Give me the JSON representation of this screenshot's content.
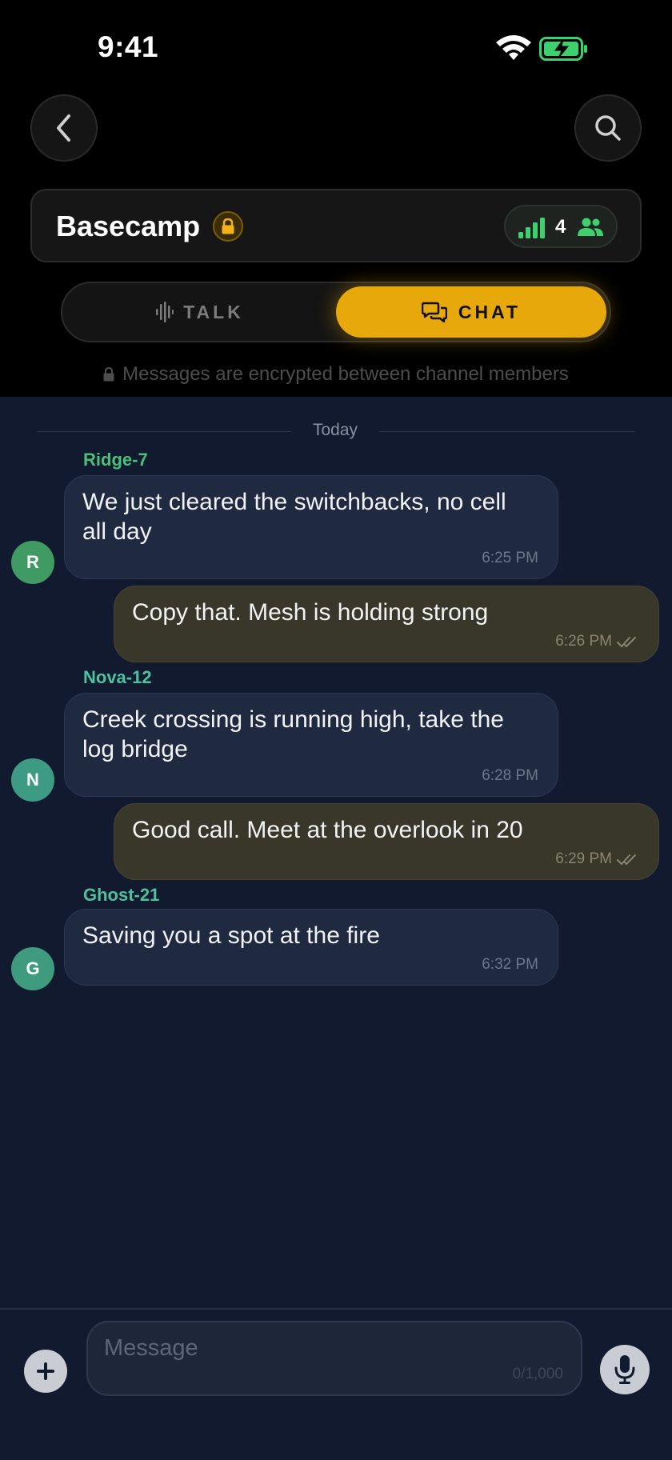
{
  "status_bar": {
    "time": "9:41"
  },
  "channel": {
    "name": "Basecamp",
    "member_count": "4"
  },
  "modes": {
    "talk": "TALK",
    "chat": "CHAT",
    "active": "chat"
  },
  "encryption_note": "Messages are encrypted between channel members",
  "day_divider": "Today",
  "messages": [
    {
      "direction": "in",
      "sender": "Ridge-7",
      "avatar": "R",
      "avatar_color": "#3f9a63",
      "sender_color": "#4bbf7a",
      "text": "We just cleared the switchbacks, no cell all day",
      "time": "6:25 PM"
    },
    {
      "direction": "out",
      "text": "Copy that. Mesh is holding strong",
      "time": "6:26 PM"
    },
    {
      "direction": "in",
      "sender": "Nova-12",
      "avatar": "N",
      "avatar_color": "#3e9b83",
      "sender_color": "#4fc1a0",
      "text": "Creek crossing is running high, take the log bridge",
      "time": "6:28 PM"
    },
    {
      "direction": "out",
      "text": "Good call. Meet at the overlook in 20",
      "time": "6:29 PM"
    },
    {
      "direction": "in",
      "sender": "Ghost-21",
      "avatar": "G",
      "avatar_color": "#3e9b7e",
      "sender_color": "#4fc09b",
      "text": "Saving you a spot at the fire",
      "time": "6:32 PM"
    }
  ],
  "composer": {
    "placeholder": "Message",
    "counter": "0/1,000"
  },
  "colors": {
    "accent": "#e7a80b",
    "chat_bg": "#111a2e",
    "member_green": "#3ecf6e"
  },
  "icons": {
    "back": "chevron-left-icon",
    "search": "search-icon",
    "lock": "lock-icon",
    "signal": "signal-bars-icon",
    "members": "people-icon",
    "talk": "waveform-icon",
    "chat": "chat-bubbles-icon",
    "add": "plus-icon",
    "mic": "microphone-icon",
    "read": "double-check-icon"
  }
}
